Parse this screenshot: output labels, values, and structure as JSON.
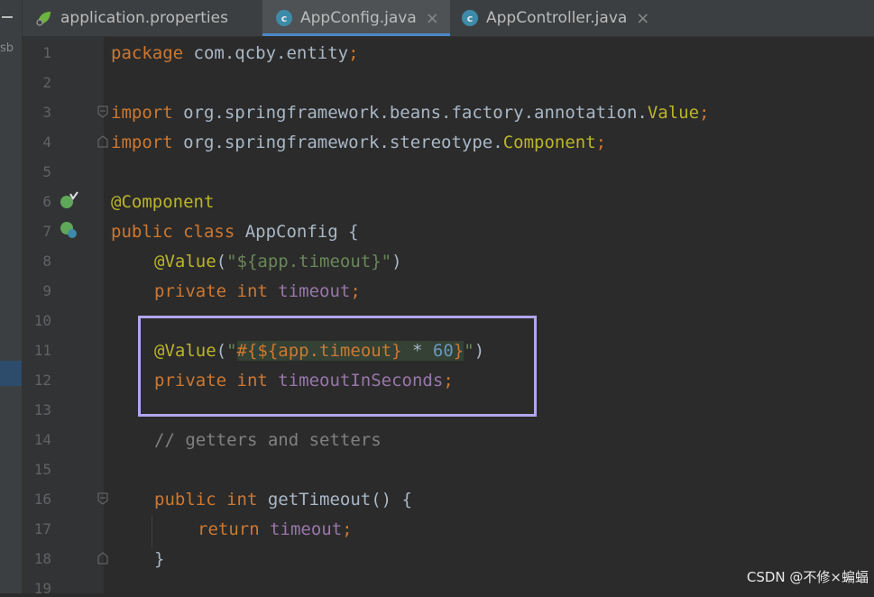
{
  "sidebar": {
    "label": "sb"
  },
  "tabs": [
    {
      "label": "application.properties",
      "icon": "spring-leaf-icon",
      "active": false
    },
    {
      "label": "AppConfig.java",
      "icon": "java-class-icon",
      "active": true,
      "close": "×"
    },
    {
      "label": "AppController.java",
      "icon": "java-class-icon",
      "active": false,
      "close": "×"
    }
  ],
  "class_icon_letter": "c",
  "line_numbers": [
    "1",
    "2",
    "3",
    "4",
    "5",
    "6",
    "7",
    "8",
    "9",
    "10",
    "11",
    "12",
    "13",
    "14",
    "15",
    "16",
    "17",
    "18",
    "19"
  ],
  "code": {
    "l1": {
      "kw": "package",
      "id": " com.qcby.entity",
      "semi": ";"
    },
    "l3": {
      "kw": "import",
      "id": " org.springframework.beans.factory.annotation.",
      "cls": "Value",
      "semi": ";"
    },
    "l4": {
      "kw": "import",
      "id": " org.springframework.stereotype.",
      "cls": "Component",
      "semi": ";"
    },
    "l6": {
      "ann": "@Component"
    },
    "l7": {
      "kw": "public class",
      "id": " AppConfig {"
    },
    "l8": {
      "ann": "@Value",
      "open": "(",
      "str": "\"${app.timeout}\"",
      "close": ")"
    },
    "l9": {
      "kw": "private int",
      "fld": " timeout",
      "semi": ";"
    },
    "l11": {
      "ann": "@Value",
      "open": "(",
      "q1": "\"",
      "expr1": "#{${app.timeout}",
      "op": " * ",
      "num": "60",
      "brace": "}",
      "q2": "\"",
      "close": ")"
    },
    "l12": {
      "kw": "private int",
      "fld": " timeoutInSeconds",
      "semi": ";"
    },
    "l14": {
      "cmt": "// getters and setters"
    },
    "l16": {
      "kw": "public int",
      "id": " getTimeout() {"
    },
    "l17": {
      "kw": "return",
      "fld": " timeout",
      "semi": ";"
    },
    "l18": {
      "id": "}"
    }
  },
  "watermark": "CSDN @不修×蝙蝠",
  "colors": {
    "keyword": "#cc7832",
    "annotation": "#bbb529",
    "string": "#6a8759",
    "field": "#9876aa",
    "number": "#6897bb",
    "comment": "#808080",
    "highlight_box": "#b1a6ef"
  }
}
